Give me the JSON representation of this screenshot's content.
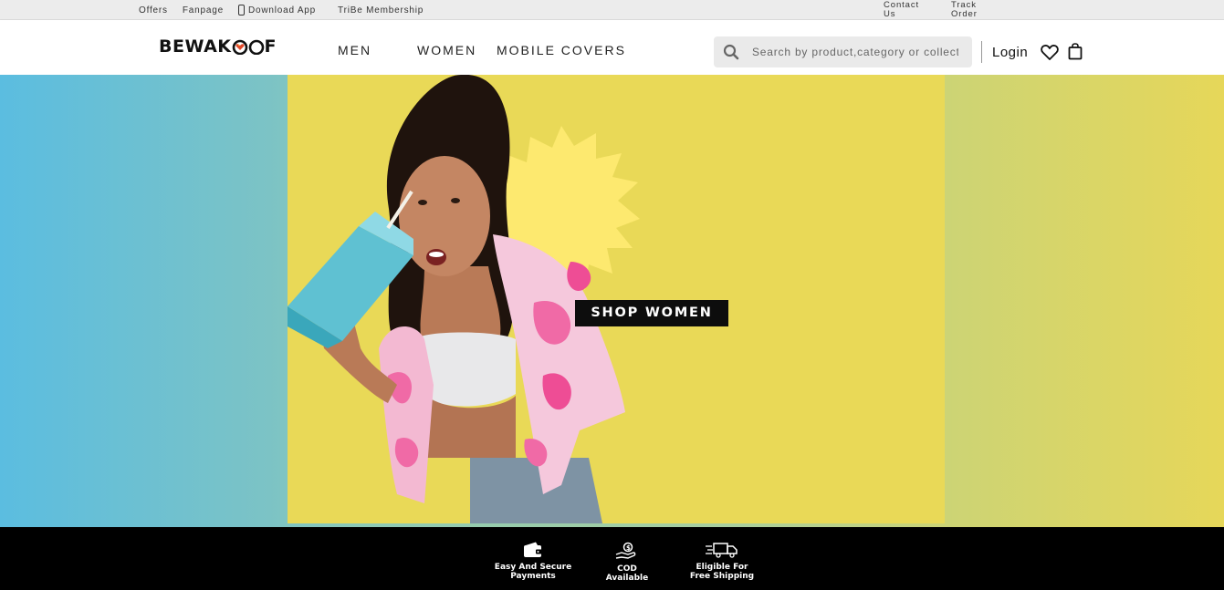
{
  "topbar": {
    "links": [
      "Offers",
      "Fanpage",
      "Download App",
      "TriBe Membership"
    ],
    "contact": "Contact Us",
    "track": "Track Order"
  },
  "header": {
    "logo_text": "BEWAK",
    "logo_tail": "F",
    "nav": [
      "MEN",
      "WOMEN",
      "MOBILE COVERS"
    ],
    "search_placeholder": "Search by product,category or collection",
    "login": "Login"
  },
  "hero": {
    "cta": "SHOP WOMEN"
  },
  "features": [
    {
      "line1": "Easy And Secure",
      "line2": "Payments",
      "icon": "wallet-icon"
    },
    {
      "line1": "COD",
      "line2": "Available",
      "icon": "cash-hand-icon"
    },
    {
      "line1": "Eligible For",
      "line2": "Free Shipping",
      "icon": "delivery-truck-icon"
    }
  ],
  "colors": {
    "brand_yellow": "#e9d957",
    "hero_left": "#5bbde0",
    "black": "#000000",
    "pink_shirt": "#f06aa6"
  }
}
